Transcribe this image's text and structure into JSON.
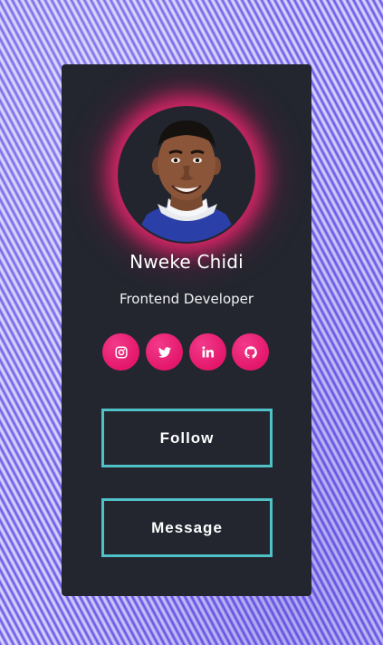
{
  "profile": {
    "name": "Nweke Chidi",
    "title": "Frontend Developer"
  },
  "socials": [
    {
      "icon": "instagram-icon"
    },
    {
      "icon": "twitter-icon"
    },
    {
      "icon": "linkedin-icon"
    },
    {
      "icon": "github-icon"
    }
  ],
  "actions": {
    "follow_label": "Follow",
    "message_label": "Message"
  },
  "colors": {
    "card_background": "#23262f",
    "accent_pink": "#e4176b",
    "button_border": "#4fc1c7",
    "page_background": "#a79cf4"
  }
}
